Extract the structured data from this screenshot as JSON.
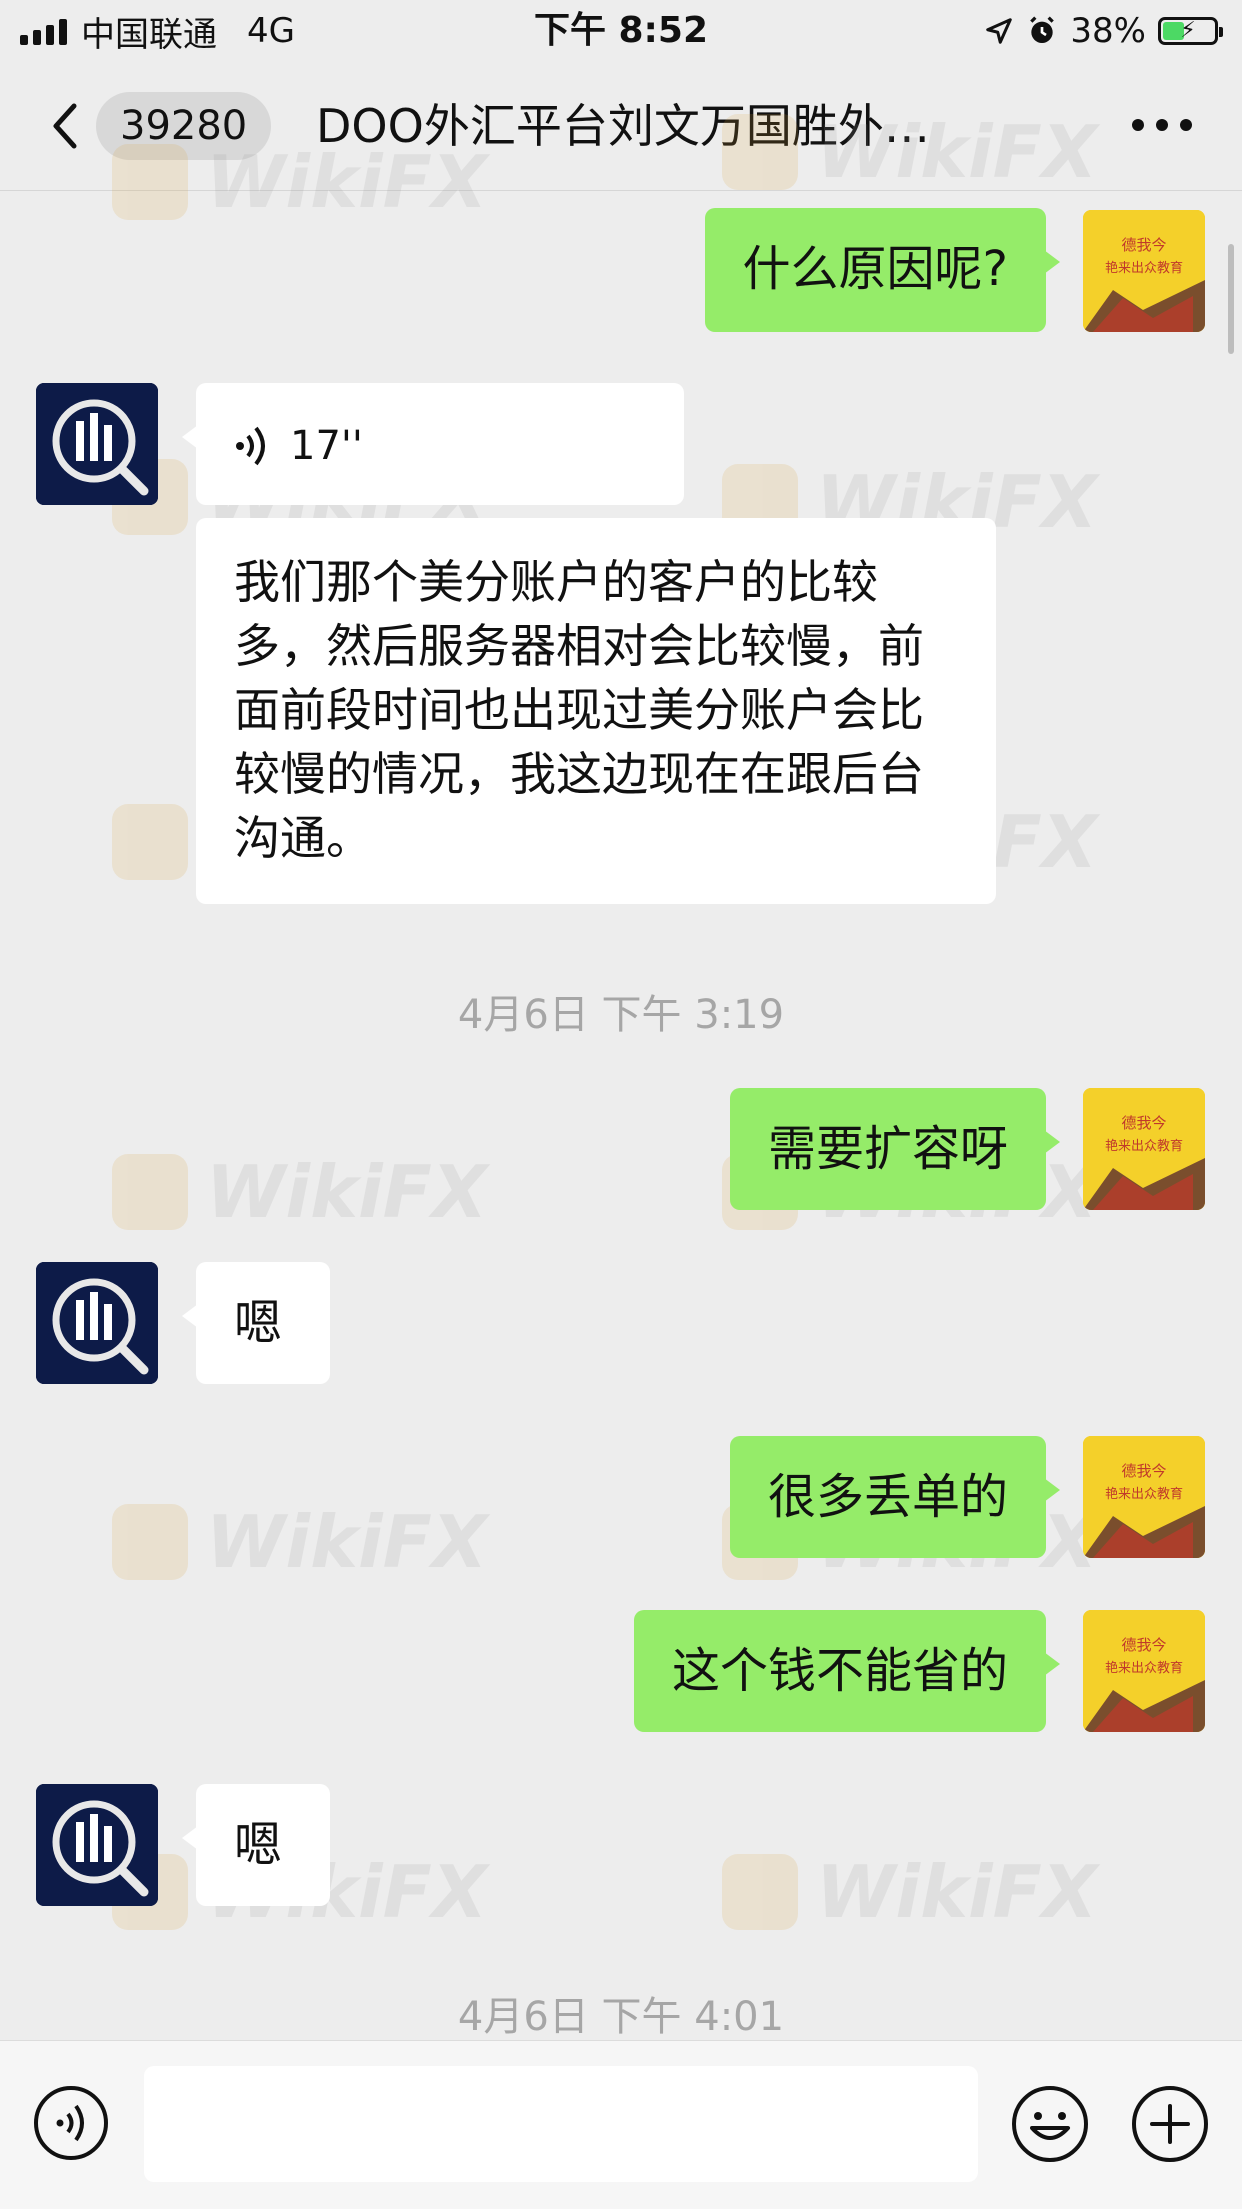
{
  "status_bar": {
    "carrier": "中国联通",
    "network": "4G",
    "time": "下午 8:52",
    "battery": "38%"
  },
  "header": {
    "unread_count": "39280",
    "title": "DOO外汇平台刘文万国胜外…"
  },
  "watermark": "WikiFX",
  "messages": [
    {
      "sender": "me",
      "text": "什么原因呢?"
    },
    {
      "sender": "other",
      "voice_duration": "17''",
      "text": "我们那个美分账户的客户的比较多，然后服务器相对会比较慢，前面前段时间也出现过美分账户会比较慢的情况，我这边现在在跟后台沟通。"
    },
    {
      "timestamp": "4月6日 下午 3:19"
    },
    {
      "sender": "me",
      "text": "需要扩容呀"
    },
    {
      "sender": "other",
      "text": "嗯"
    },
    {
      "sender": "me",
      "text": "很多丢单的"
    },
    {
      "sender": "me",
      "text": "这个钱不能省的"
    },
    {
      "sender": "other",
      "text": "嗯"
    },
    {
      "timestamp": "4月6日 下午 4:01"
    }
  ],
  "input": {
    "placeholder": ""
  },
  "avatar_me": {
    "line1": "德我今",
    "line2": "艳来出众教育"
  }
}
